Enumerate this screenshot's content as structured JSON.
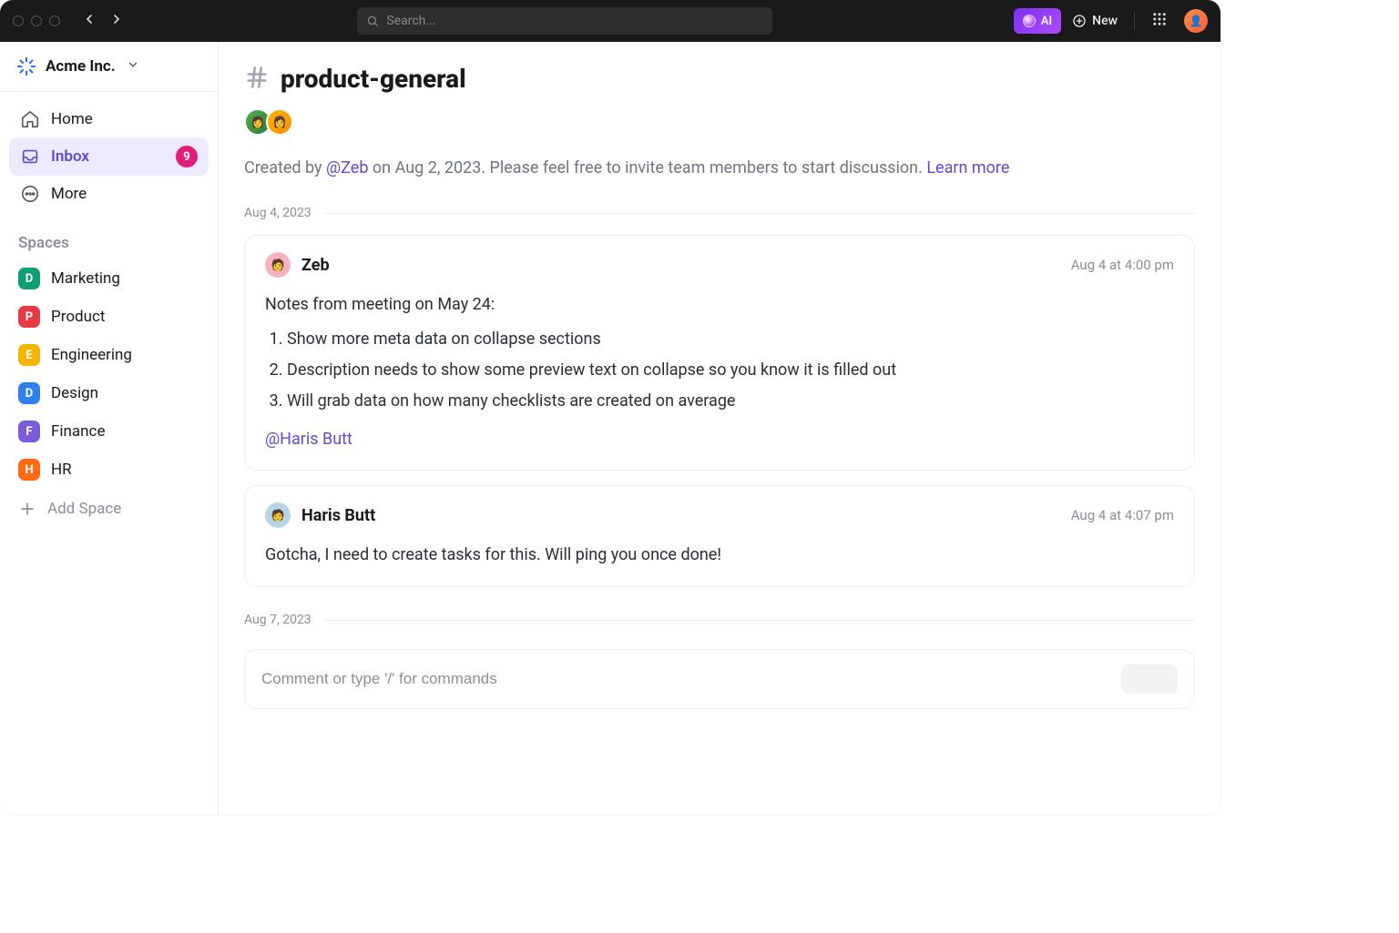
{
  "topbar": {
    "search_placeholder": "Search...",
    "ai_label": "AI",
    "new_label": "New"
  },
  "workspace": {
    "name": "Acme Inc."
  },
  "nav": {
    "home": "Home",
    "inbox": "Inbox",
    "inbox_badge": "9",
    "more": "More"
  },
  "spaces_header": "Spaces",
  "spaces": [
    {
      "letter": "D",
      "color": "#0f9d76",
      "label": "Marketing"
    },
    {
      "letter": "P",
      "color": "#e63946",
      "label": "Product"
    },
    {
      "letter": "E",
      "color": "#f4b400",
      "label": "Engineering"
    },
    {
      "letter": "D",
      "color": "#2f80ed",
      "label": "Design"
    },
    {
      "letter": "F",
      "color": "#7b5bd6",
      "label": "Finance"
    },
    {
      "letter": "H",
      "color": "#ff6a13",
      "label": "HR"
    }
  ],
  "add_space": "Add Space",
  "channel": {
    "name": "product-general",
    "created_prefix": "Created by ",
    "created_mention": "@Zeb",
    "created_suffix": " on Aug 2, 2023. Please feel free to invite team members to start discussion. ",
    "learn_more": "Learn more"
  },
  "date_sep_1": "Aug 4, 2023",
  "date_sep_2": "Aug 7, 2023",
  "messages": [
    {
      "author": "Zeb",
      "time": "Aug 4 at 4:00 pm",
      "avatar_color": "#f7b3c1",
      "intro": "Notes from meeting on May 24:",
      "items": [
        "Show more meta data on collapse sections",
        "Description needs to show some preview text on collapse so you know it is filled out",
        "Will grab data on how many checklists are created on average"
      ],
      "mention": "@Haris Butt"
    },
    {
      "author": "Haris Butt",
      "time": "Aug 4 at 4:07 pm",
      "avatar_color": "#b6d6e8",
      "text": "Gotcha, I need to create tasks for this. Will ping you once done!"
    }
  ],
  "composer": {
    "placeholder": "Comment or type '/' for commands"
  }
}
